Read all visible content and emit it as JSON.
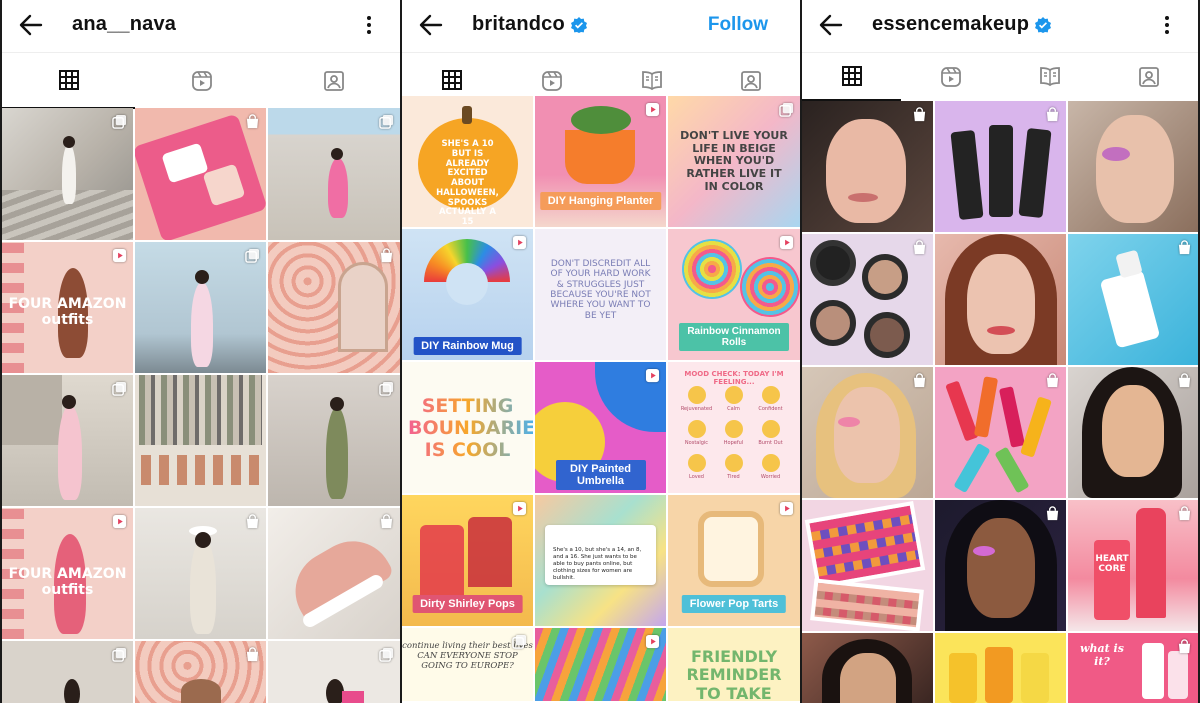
{
  "panels": [
    {
      "username": "ana__nava",
      "verified": false,
      "action": "",
      "tabs": [
        "grid",
        "reels",
        "tagged"
      ],
      "active_tab": "grid",
      "posts": [
        {
          "overlay": "",
          "badge": "multi"
        },
        {
          "overlay": "",
          "badge": "shop"
        },
        {
          "overlay": "",
          "badge": "multi"
        },
        {
          "overlay": "FOUR AMAZON\noutfits",
          "badge": "reel"
        },
        {
          "overlay": "",
          "badge": "multi"
        },
        {
          "overlay": "",
          "badge": "shop"
        },
        {
          "overlay": "",
          "badge": "multi"
        },
        {
          "overlay": "",
          "badge": ""
        },
        {
          "overlay": "",
          "badge": "multi"
        },
        {
          "overlay": "FOUR AMAZON\noutfits",
          "badge": "reel"
        },
        {
          "overlay": "",
          "badge": "shop"
        },
        {
          "overlay": "",
          "badge": "shop"
        },
        {
          "overlay": "",
          "badge": "multi"
        },
        {
          "overlay": "",
          "badge": "shop"
        },
        {
          "overlay": "",
          "badge": "multi"
        }
      ]
    },
    {
      "username": "britandco",
      "verified": true,
      "action": "Follow",
      "tabs": [
        "grid",
        "reels",
        "guides",
        "tagged"
      ],
      "active_tab": "grid",
      "posts": [
        {
          "overlay": "SHE'S A 10 BUT IS ALREADY EXCITED ABOUT HALLOWEEN, SPOOKS ACTUALLY A 15",
          "label": "",
          "badge": ""
        },
        {
          "overlay": "",
          "label": "DIY Hanging Planter",
          "badge": "reel"
        },
        {
          "overlay": "DON'T LIVE YOUR LIFE IN BEIGE WHEN YOU'D RATHER LIVE IT IN COLOR",
          "label": "",
          "badge": "multi"
        },
        {
          "overlay": "",
          "label": "DIY Rainbow Mug",
          "badge": "reel"
        },
        {
          "overlay": "DON'T DISCREDIT ALL OF YOUR HARD WORK & STRUGGLES JUST BECAUSE YOU'RE NOT WHERE YOU WANT TO BE YET",
          "label": "",
          "badge": ""
        },
        {
          "overlay": "",
          "label": "Rainbow Cinnamon Rolls",
          "badge": "reel"
        },
        {
          "overlay": "SETTING BOUNDARIES IS COOL",
          "label": "",
          "badge": ""
        },
        {
          "overlay": "",
          "label": "DIY Painted Umbrella",
          "badge": "reel"
        },
        {
          "overlay": "MOOD CHECK: TODAY I'M FEELING...",
          "label": "",
          "badge": ""
        },
        {
          "overlay": "",
          "label": "Dirty Shirley Pops",
          "badge": "reel"
        },
        {
          "overlay": "She's a 10, but she's a 14, an 8, and a 16. She just wants to be able to buy pants online, but clothing sizes for women are bullshit.",
          "label": "",
          "badge": ""
        },
        {
          "overlay": "",
          "label": "Flower Pop Tarts",
          "badge": "reel"
        },
        {
          "overlay": "continue living their best lives\nCAN EVERYONE STOP GOING TO EUROPE?",
          "label": "",
          "badge": "multi"
        },
        {
          "overlay": "",
          "label": "",
          "badge": "reel"
        },
        {
          "overlay": "FRIENDLY REMINDER TO TAKE CARE",
          "label": "",
          "badge": ""
        }
      ],
      "mood_labels": [
        "Rejuvenated",
        "Calm",
        "Confident",
        "Nostalgic",
        "Hopeful",
        "Burnt Out",
        "Loved",
        "Tired",
        "Worried"
      ]
    },
    {
      "username": "essencemakeup",
      "verified": true,
      "action": "",
      "tabs": [
        "grid",
        "reels",
        "guides",
        "tagged"
      ],
      "active_tab": "grid",
      "posts": [
        {
          "overlay": "",
          "badge": "shop"
        },
        {
          "overlay": "",
          "badge": "shop"
        },
        {
          "overlay": "",
          "badge": ""
        },
        {
          "overlay": "",
          "badge": "shop"
        },
        {
          "overlay": "",
          "badge": ""
        },
        {
          "overlay": "",
          "badge": "shop"
        },
        {
          "overlay": "",
          "badge": "shop"
        },
        {
          "overlay": "",
          "badge": "shop"
        },
        {
          "overlay": "",
          "badge": "shop"
        },
        {
          "overlay": "",
          "badge": ""
        },
        {
          "overlay": "",
          "badge": "shop"
        },
        {
          "overlay": "HEART CORE",
          "badge": "shop"
        },
        {
          "overlay": "",
          "badge": ""
        },
        {
          "overlay": "",
          "badge": ""
        },
        {
          "overlay": "what is it?",
          "badge": "shop"
        }
      ]
    }
  ],
  "colors": {
    "accent": "#1c96ec",
    "verified": "#1c96ec",
    "text": "#111111"
  }
}
